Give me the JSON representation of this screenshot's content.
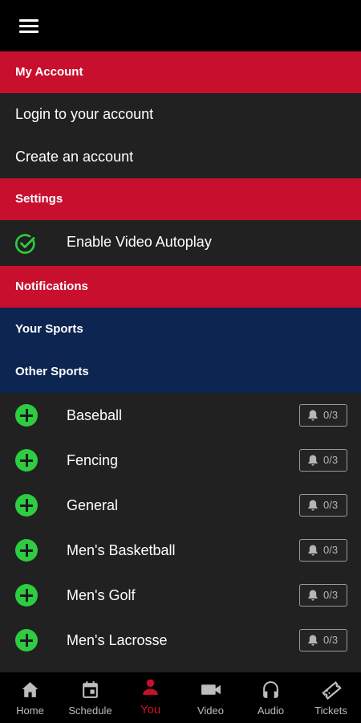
{
  "menu_icon": "hamburger-icon",
  "sections": {
    "account_header": "My Account",
    "login": "Login to your account",
    "create": "Create an account",
    "settings_header": "Settings",
    "autoplay": "Enable Video Autoplay",
    "notifications_header": "Notifications",
    "your_sports": "Your Sports",
    "other_sports": "Other Sports"
  },
  "sports": [
    {
      "name": "Baseball",
      "count": "0/3"
    },
    {
      "name": "Fencing",
      "count": "0/3"
    },
    {
      "name": "General",
      "count": "0/3"
    },
    {
      "name": "Men's Basketball",
      "count": "0/3"
    },
    {
      "name": "Men's Golf",
      "count": "0/3"
    },
    {
      "name": "Men's Lacrosse",
      "count": "0/3"
    }
  ],
  "nav": [
    {
      "label": "Home",
      "icon": "home-icon"
    },
    {
      "label": "Schedule",
      "icon": "calendar-icon"
    },
    {
      "label": "You",
      "icon": "person-icon",
      "active": true
    },
    {
      "label": "Video",
      "icon": "video-camera-icon"
    },
    {
      "label": "Audio",
      "icon": "headphones-icon"
    },
    {
      "label": "Tickets",
      "icon": "ticket-icon"
    }
  ],
  "colors": {
    "accent": "#c8102e",
    "navy": "#0c2551",
    "green": "#2ecc40",
    "background": "#212121"
  }
}
